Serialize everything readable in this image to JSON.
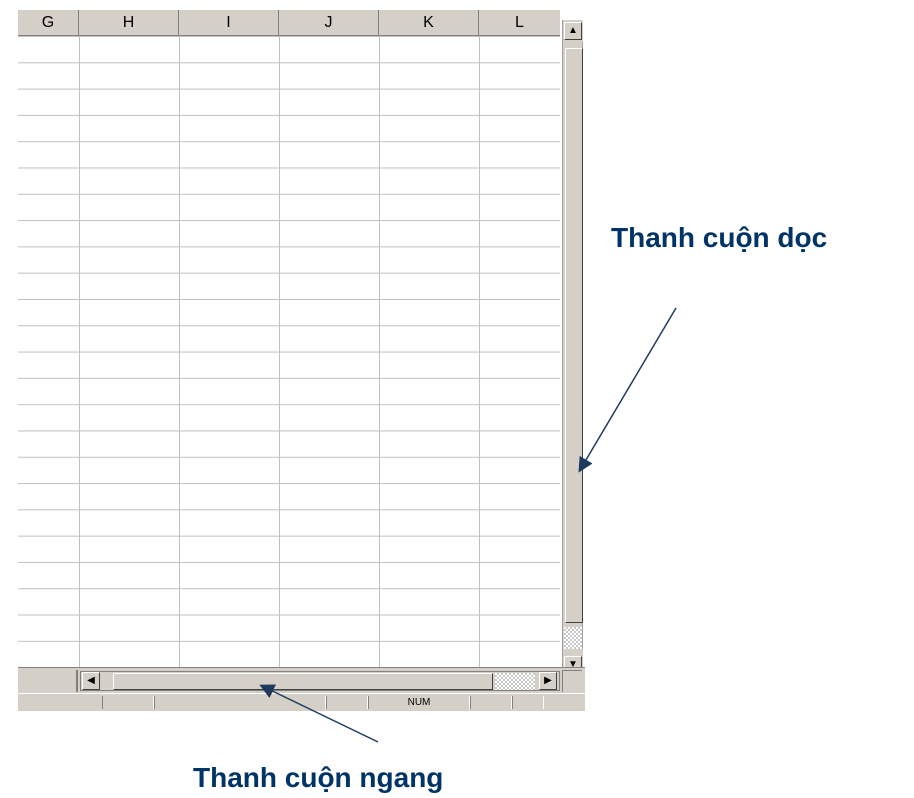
{
  "spreadsheet": {
    "columns": [
      "G",
      "H",
      "I",
      "J",
      "K",
      "L"
    ]
  },
  "scrollbars": {
    "up_arrow": "▲",
    "down_arrow": "▼",
    "left_arrow": "◀",
    "right_arrow": "▶"
  },
  "status_bar": {
    "indicator": "NUM"
  },
  "annotations": {
    "vertical": "Thanh cuộn dọc",
    "horizontal": "Thanh cuộn ngang"
  },
  "colors": {
    "annotation_text": "#003366",
    "arrow": "#1f3a5f",
    "chrome": "#d4d0c8"
  }
}
